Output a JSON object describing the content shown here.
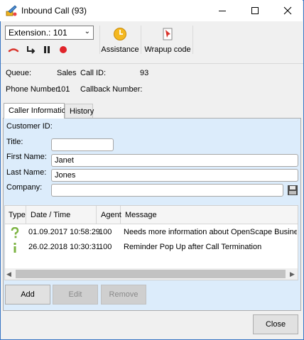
{
  "window": {
    "title": "Inbound Call (93)"
  },
  "toolbar": {
    "extension_value": "Extension.: 101",
    "assistance_label": "Assistance",
    "wrapup_label": "Wrapup code"
  },
  "info": {
    "queue_label": "Queue:",
    "queue_value": "Sales",
    "callid_label": "Call ID:",
    "callid_value": "93",
    "phone_label": "Phone Number:",
    "phone_value": "101",
    "callback_label": "Callback Number:",
    "callback_value": ""
  },
  "tabs": [
    {
      "label": "Caller Information",
      "active": true
    },
    {
      "label": "History",
      "active": false
    }
  ],
  "form": {
    "customer_id_label": "Customer ID:",
    "title_label": "Title:",
    "title_value": "",
    "first_name_label": "First Name:",
    "first_name_value": "Janet",
    "last_name_label": "Last Name:",
    "last_name_value": "Jones",
    "company_label": "Company:",
    "company_value": ""
  },
  "grid": {
    "columns": [
      "Type",
      "Date / Time",
      "Agent",
      "Message"
    ],
    "rows": [
      {
        "type_icon": "question-icon",
        "datetime": "01.09.2017 10:58:29",
        "agent": "100",
        "message": "Needs more information about OpenScape Business"
      },
      {
        "type_icon": "info-icon",
        "datetime": "26.02.2018 10:30:31",
        "agent": "100",
        "message": "Reminder Pop Up after Call Termination"
      }
    ]
  },
  "buttons": {
    "add": "Add",
    "edit": "Edit",
    "remove": "Remove",
    "close": "Close"
  },
  "colors": {
    "panel_bg": "#dcecfb",
    "hangup": "#d9332b",
    "record": "#e0242a",
    "question": "#7cb342",
    "info": "#7cb342"
  }
}
